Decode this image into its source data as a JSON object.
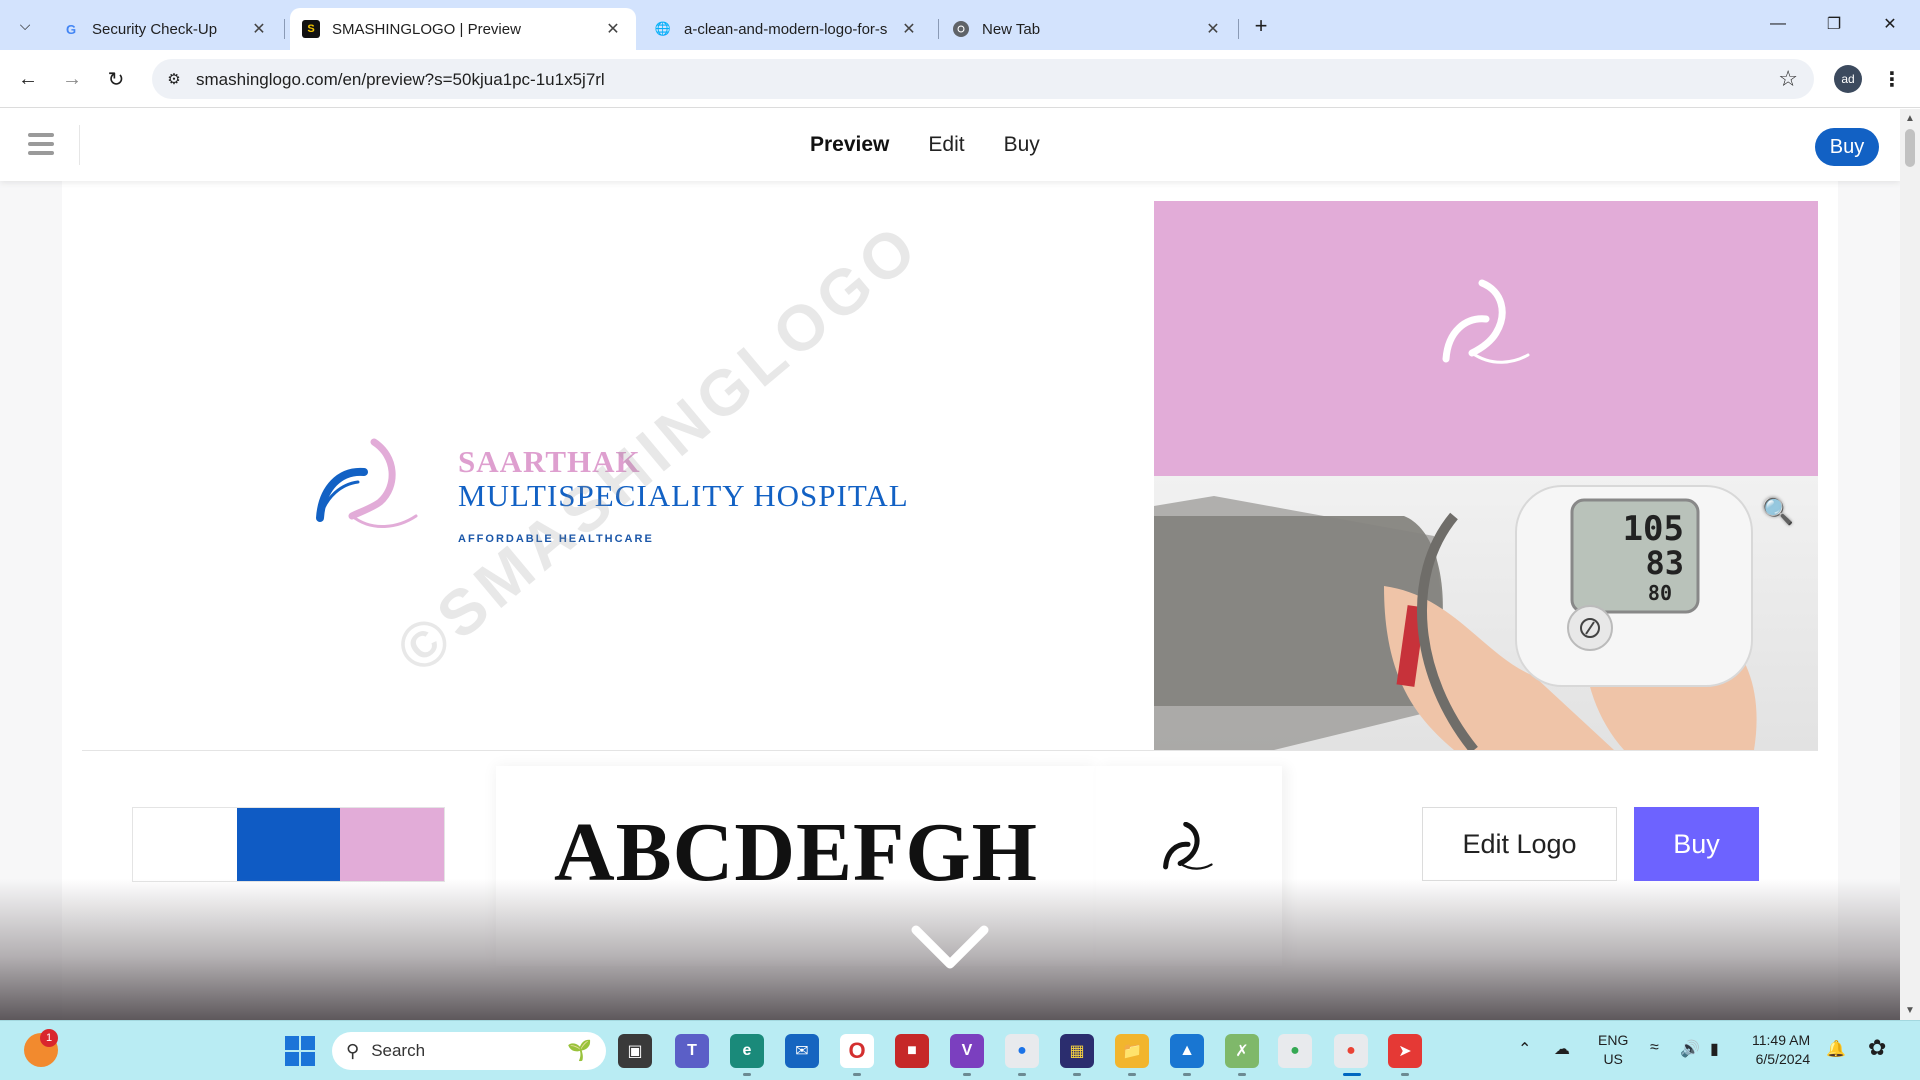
{
  "browser": {
    "tabs": [
      {
        "title": "Security Check-Up",
        "favicon": "google-g-icon",
        "active": false
      },
      {
        "title": "SMASHINGLOGO | Preview",
        "favicon": "smashinglogo-icon",
        "active": true
      },
      {
        "title": "a-clean-and-modern-logo-for-s",
        "favicon": "globe-icon",
        "active": false
      },
      {
        "title": "New Tab",
        "favicon": "chrome-icon",
        "active": false
      }
    ],
    "url": "smashinglogo.com/en/preview?s=50kjua1pc-1u1x5j7rl",
    "profile_initials": "ad"
  },
  "site": {
    "nav": [
      {
        "label": "Preview",
        "active": true
      },
      {
        "label": "Edit",
        "active": false
      },
      {
        "label": "Buy",
        "active": false
      }
    ],
    "header_buy_label": "Buy"
  },
  "logo": {
    "name_line1": "SAARTHAK",
    "name_line2": "MULTISPECIALITY HOSPITAL",
    "tagline": "AFFORDABLE HEALTHCARE",
    "watermark": "©SMASHINGLOGO",
    "colors": {
      "pink": "#e2acd8",
      "blue": "#1261c4"
    }
  },
  "assets": {
    "palette": [
      "#ffffff",
      "#0f5bc4",
      "#e2acd8"
    ],
    "font_sample": "ABCDEFGH",
    "monitor_display": [
      "105",
      "83",
      "80"
    ]
  },
  "actions": {
    "edit_label": "Edit Logo",
    "buy_label": "Buy",
    "buy_color": "#6d63ff"
  },
  "taskbar": {
    "search_placeholder": "Search",
    "weather_badge": "1",
    "lang_line1": "ENG",
    "lang_line2": "US",
    "time": "11:49 AM",
    "date": "6/5/2024"
  }
}
